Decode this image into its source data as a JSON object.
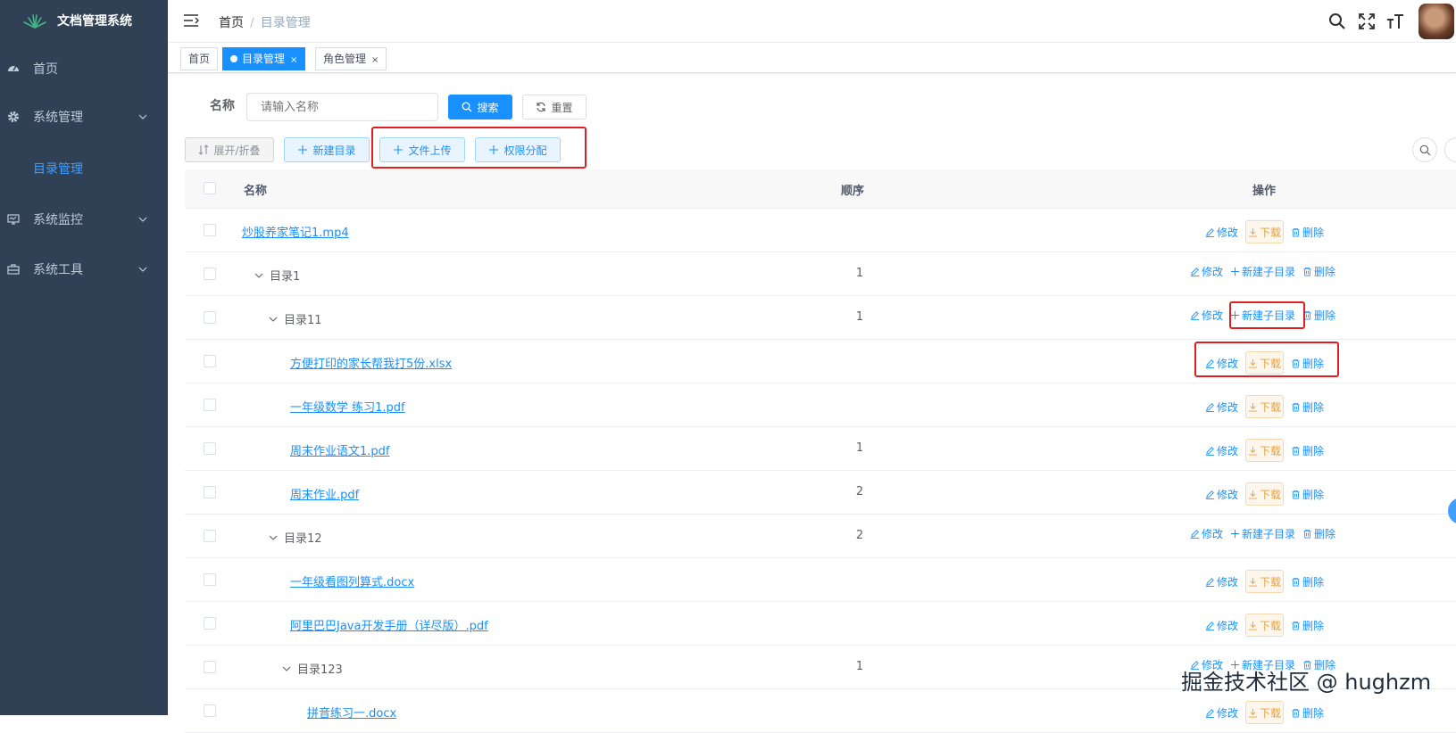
{
  "app": {
    "title": "文档管理系统"
  },
  "sidebar": {
    "items": [
      {
        "label": "首页",
        "icon": "dashboard-icon"
      },
      {
        "label": "系统管理",
        "icon": "gear-icon"
      },
      {
        "label": "目录管理"
      },
      {
        "label": "系统监控",
        "icon": "monitor-icon"
      },
      {
        "label": "系统工具",
        "icon": "toolbox-icon"
      }
    ]
  },
  "header": {
    "breadcrumb": {
      "home": "首页",
      "separator": "/",
      "current": "目录管理"
    }
  },
  "tags": [
    {
      "label": "首页"
    },
    {
      "label": "目录管理",
      "close": "×"
    },
    {
      "label": "角色管理",
      "close": "×"
    }
  ],
  "search": {
    "label": "名称",
    "placeholder": "请输入名称",
    "search_button": "搜索",
    "reset_button": "重置"
  },
  "toolbar": {
    "expand": "展开/折叠",
    "new_dir": "新建目录",
    "upload": "文件上传",
    "permission": "权限分配"
  },
  "table": {
    "columns": {
      "name": "名称",
      "order": "顺序",
      "actions": "操作"
    },
    "op_labels": {
      "edit": "修改",
      "download": "下载",
      "new_sub": "新建子目录",
      "delete": "删除"
    },
    "rows": [
      {
        "name": "炒股养家笔记1.mp4",
        "order": "",
        "type": "file"
      },
      {
        "name": "目录1",
        "order": "1",
        "type": "folder"
      },
      {
        "name": "目录11",
        "order": "1",
        "type": "folder"
      },
      {
        "name": "方便打印的家长帮我打5份.xlsx",
        "order": "",
        "type": "file"
      },
      {
        "name": "一年级数学 练习1.pdf",
        "order": "",
        "type": "file"
      },
      {
        "name": "周末作业语文1.pdf",
        "order": "1",
        "type": "file"
      },
      {
        "name": "周末作业.pdf",
        "order": "2",
        "type": "file"
      },
      {
        "name": "目录12",
        "order": "2",
        "type": "folder"
      },
      {
        "name": "一年级看图列算式.docx",
        "order": "",
        "type": "file"
      },
      {
        "name": "阿里巴巴Java开发手册（详尽版）.pdf",
        "order": "",
        "type": "file"
      },
      {
        "name": "目录123",
        "order": "1",
        "type": "folder"
      },
      {
        "name": "拼音练习一.docx",
        "order": "",
        "type": "file"
      }
    ]
  },
  "watermark": "掘金技术社区 @ hughzm",
  "colors": {
    "primary": "#1890ff",
    "sidebar_bg": "#304156",
    "warning": "#e6a23c",
    "highlight": "#e02020"
  }
}
